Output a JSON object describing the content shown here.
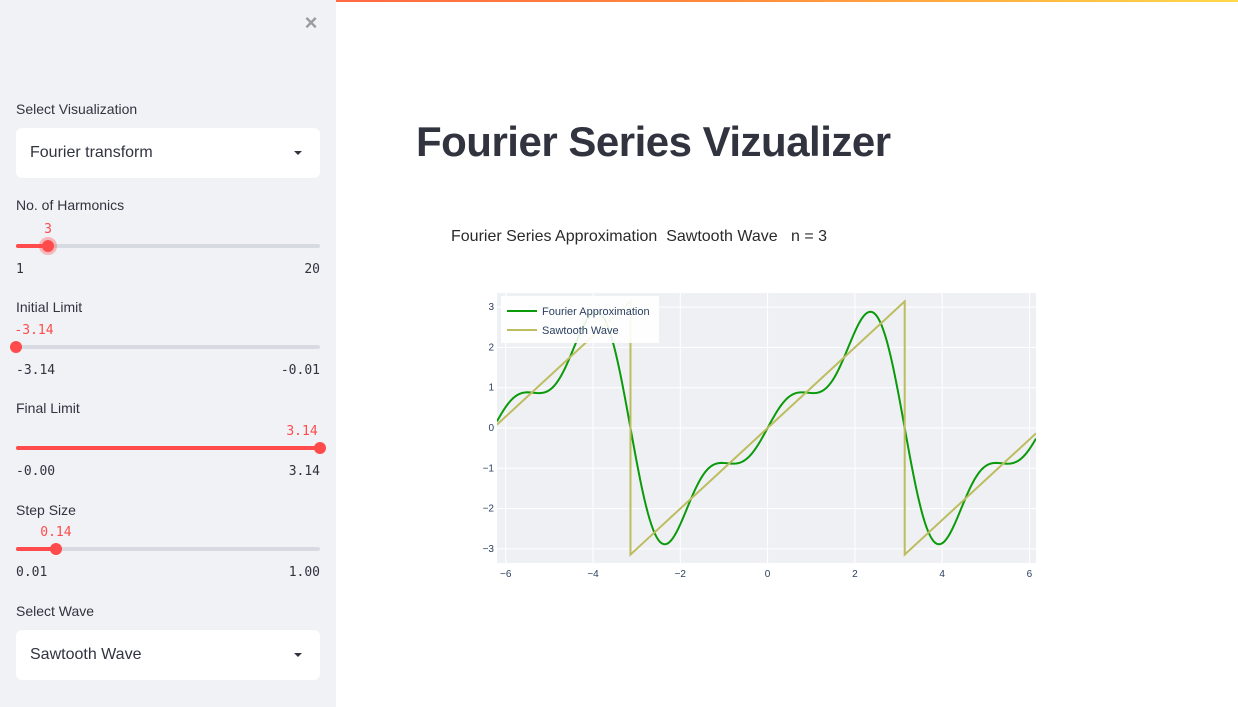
{
  "sidebar": {
    "close_label": "×",
    "visualization": {
      "label": "Select Visualization",
      "value": "Fourier transform"
    },
    "harmonics": {
      "label": "No. of Harmonics",
      "value": "3",
      "min": "1",
      "max": "20",
      "fraction": 0.1053
    },
    "initial_limit": {
      "label": "Initial Limit",
      "value": "-3.14",
      "min": "-3.14",
      "max": "-0.01",
      "fraction": 0.0
    },
    "final_limit": {
      "label": "Final Limit",
      "value": "3.14",
      "min": "-0.00",
      "max": "3.14",
      "fraction": 1.0
    },
    "step_size": {
      "label": "Step Size",
      "value": "0.14",
      "min": "0.01",
      "max": "1.00",
      "fraction": 0.1313
    },
    "wave": {
      "label": "Select Wave",
      "value": "Sawtooth Wave"
    }
  },
  "main": {
    "title": "Fourier Series Vizualizer"
  },
  "colors": {
    "accent": "#ff4b4b",
    "sidebar_bg": "#f0f2f6",
    "fourier_line": "#0a9a0a",
    "sawtooth_line": "#bcbd5f",
    "plot_bg": "#eff0f4"
  },
  "chart_data": {
    "type": "line",
    "title": "Fourier Series Approximation  Sawtooth Wave   n = 3",
    "xlim": [
      -6.2,
      6.15
    ],
    "ylim": [
      -3.35,
      3.35
    ],
    "xticks": [
      -6,
      -4,
      -2,
      0,
      2,
      4,
      6
    ],
    "yticks": [
      -3,
      -2,
      -1,
      0,
      1,
      2,
      3
    ],
    "grid": true,
    "legend_position": "top-left",
    "series": [
      {
        "name": "Fourier Approximation",
        "function": "fourier_sawtooth",
        "harmonics": 3,
        "x_range": [
          -6.2,
          6.15
        ],
        "color": "#0a9a0a"
      },
      {
        "name": "Sawtooth Wave",
        "function": "sawtooth",
        "x_range": [
          -6.2,
          6.15
        ],
        "color": "#bcbd5f"
      }
    ]
  }
}
